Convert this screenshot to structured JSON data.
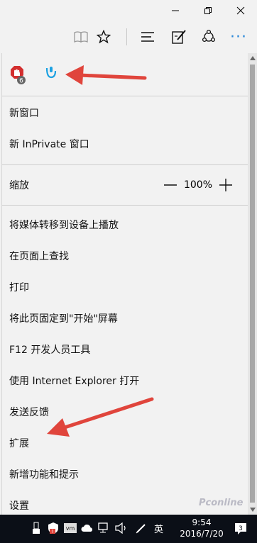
{
  "window": {
    "minimize_icon": "minimize-icon",
    "maximize_icon": "restore-icon",
    "close_icon": "close-icon"
  },
  "toolbar": {
    "icons": [
      "reading-view-icon",
      "favorite-star-icon",
      "hub-icon",
      "web-note-icon",
      "share-icon",
      "more-actions-icon"
    ],
    "more_label": "···",
    "accent": "#2b88d8"
  },
  "menu": {
    "extensions": [
      {
        "icon": "adblock-extension-icon",
        "badge": "6",
        "color": "#d32f2f"
      },
      {
        "icon": "mouse-gestures-extension-icon",
        "color": "#1ba1e2"
      }
    ],
    "new_window": "新窗口",
    "new_inprivate": "新 InPrivate 窗口",
    "zoom": {
      "label": "缩放",
      "value": "100%"
    },
    "cast_media": "将媒体转移到设备上播放",
    "find_on_page": "在页面上查找",
    "print": "打印",
    "pin_to_start": "将此页固定到\"开始\"屏幕",
    "f12_tools": "F12 开发人员工具",
    "open_with_ie": "使用 Internet Explorer 打开",
    "send_feedback": "发送反馈",
    "extensions_item": "扩展",
    "whats_new": "新增功能和提示",
    "settings": "设置"
  },
  "annotation_color": "#e0453c",
  "taskbar": {
    "ime": "英",
    "time": "9:54",
    "date": "2016/7/20",
    "notification_count": "3"
  },
  "watermark": "Pconline"
}
